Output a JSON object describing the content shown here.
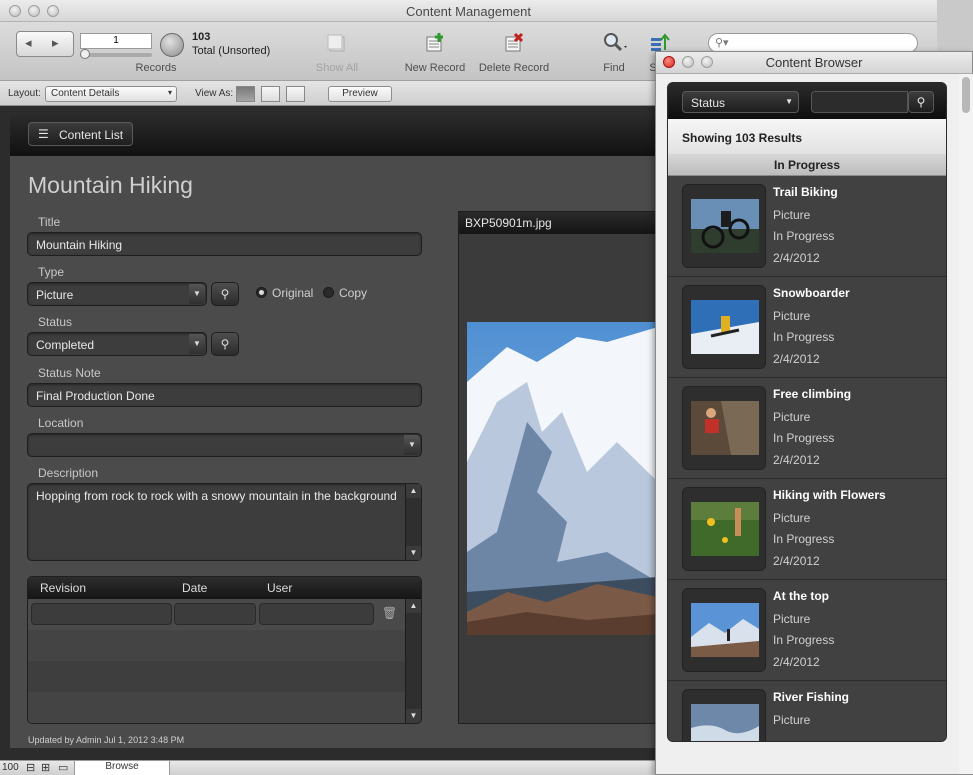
{
  "window": {
    "title": "Content Management"
  },
  "toolbar": {
    "record_field": "1",
    "records_label": "Records",
    "count": "103",
    "count_sub": "Total (Unsorted)",
    "show_all": "Show All",
    "new_record": "New Record",
    "delete_record": "Delete Record",
    "find": "Find",
    "sort_partial": "S"
  },
  "layoutbar": {
    "layout_label": "Layout:",
    "layout_value": "Content Details",
    "view_as_label": "View As:",
    "preview": "Preview"
  },
  "header": {
    "content_list": "Content List"
  },
  "record": {
    "title_display": "Mountain Hiking",
    "title_label": "Title",
    "title_value": "Mountain Hiking",
    "type_label": "Type",
    "type_value": "Picture",
    "original_label": "Original",
    "copy_label": "Copy",
    "status_label": "Status",
    "status_value": "Completed",
    "status_note_label": "Status Note",
    "status_note_value": "Final Production Done",
    "location_label": "Location",
    "location_value": "",
    "description_label": "Description",
    "description_value": "Hopping from rock to rock with a snowy mountain in the background"
  },
  "revisions": {
    "col_revision": "Revision",
    "col_date": "Date",
    "col_user": "User"
  },
  "image": {
    "filename": "BXP50901m.jpg"
  },
  "footer": {
    "updated": "Updated by Admin Jul 1, 2012 3:48 PM"
  },
  "statusbar": {
    "zoom": "100",
    "mode": "Browse"
  },
  "browser": {
    "title": "Content Browser",
    "filter_value": "Status",
    "results": "Showing 103 Results",
    "group": "In Progress",
    "items": [
      {
        "name": "Trail Biking",
        "type": "Picture",
        "status": "In Progress",
        "date": "2/4/2012"
      },
      {
        "name": "Snowboarder",
        "type": "Picture",
        "status": "In Progress",
        "date": "2/4/2012"
      },
      {
        "name": "Free climbing",
        "type": "Picture",
        "status": "In Progress",
        "date": "2/4/2012"
      },
      {
        "name": "Hiking with Flowers",
        "type": "Picture",
        "status": "In Progress",
        "date": "2/4/2012"
      },
      {
        "name": "At the top",
        "type": "Picture",
        "status": "In Progress",
        "date": "2/4/2012"
      },
      {
        "name": "River Fishing",
        "type": "Picture",
        "status": "",
        "date": ""
      }
    ]
  }
}
